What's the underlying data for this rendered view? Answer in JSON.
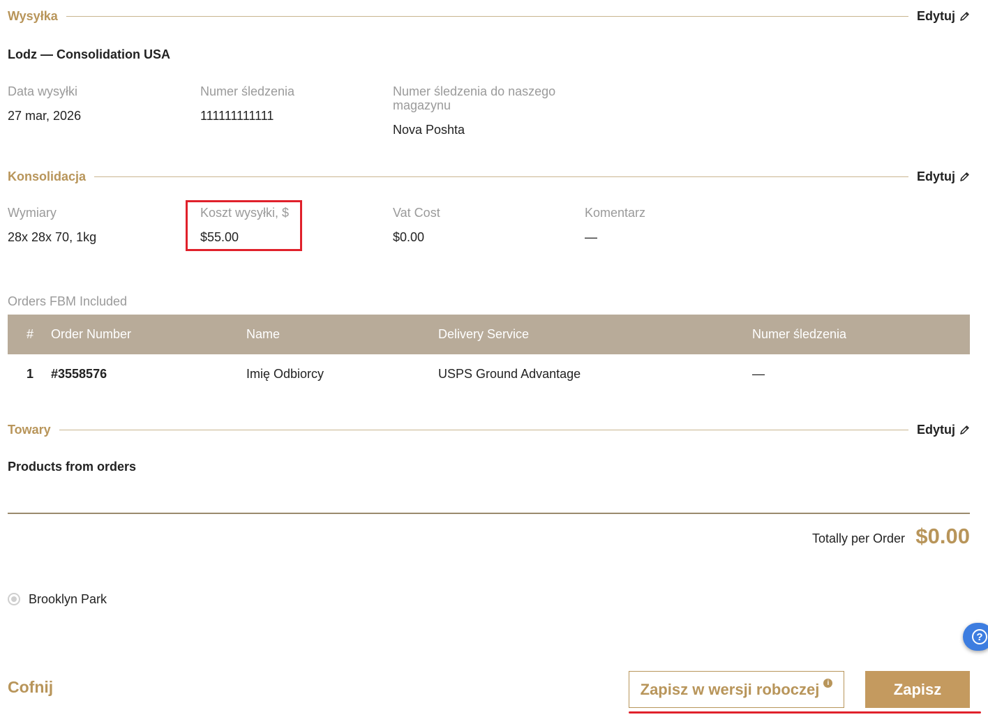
{
  "shipping": {
    "section_title": "Wysyłka",
    "edit_label": "Edytuj",
    "route": "Lodz — Consolidation USA",
    "fields": [
      {
        "label": "Data wysyłki",
        "value": "27 mar, 2026"
      },
      {
        "label": "Numer śledzenia",
        "value": "111111111111"
      },
      {
        "label": "Numer śledzenia do naszego magazynu",
        "value": "Nova Poshta"
      }
    ]
  },
  "consolidation": {
    "section_title": "Konsolidacja",
    "edit_label": "Edytuj",
    "fields": [
      {
        "label": "Wymiary",
        "value": "28x 28x 70, 1kg"
      },
      {
        "label": "Koszt wysyłki, $",
        "value": "$55.00"
      },
      {
        "label": "Vat Cost",
        "value": "$0.00"
      },
      {
        "label": "Komentarz",
        "value": "—"
      }
    ],
    "orders_label": "Orders FBM Included",
    "table": {
      "headers": [
        "#",
        "Order Number",
        "Name",
        "Delivery Service",
        "Numer śledzenia"
      ],
      "rows": [
        [
          "1",
          "#3558576",
          "Imię Odbiorcy",
          "USPS Ground Advantage",
          "—"
        ]
      ]
    }
  },
  "goods": {
    "section_title": "Towary",
    "edit_label": "Edytuj",
    "subtitle": "Products from orders",
    "total_label": "Totally per Order",
    "total_value": "$0.00"
  },
  "warehouse": {
    "option_label": "Brooklyn Park"
  },
  "help": {
    "icon": "question-icon",
    "glyph": "?"
  },
  "actions": {
    "cancel_label": "Cofnij",
    "draft_label": "Zapisz w wersji roboczej",
    "draft_info_glyph": "i",
    "save_label": "Zapisz"
  },
  "colors": {
    "accent": "#b8955a",
    "table_header": "#b8ab99",
    "highlight": "#e0212b",
    "help": "#3d7de0"
  }
}
